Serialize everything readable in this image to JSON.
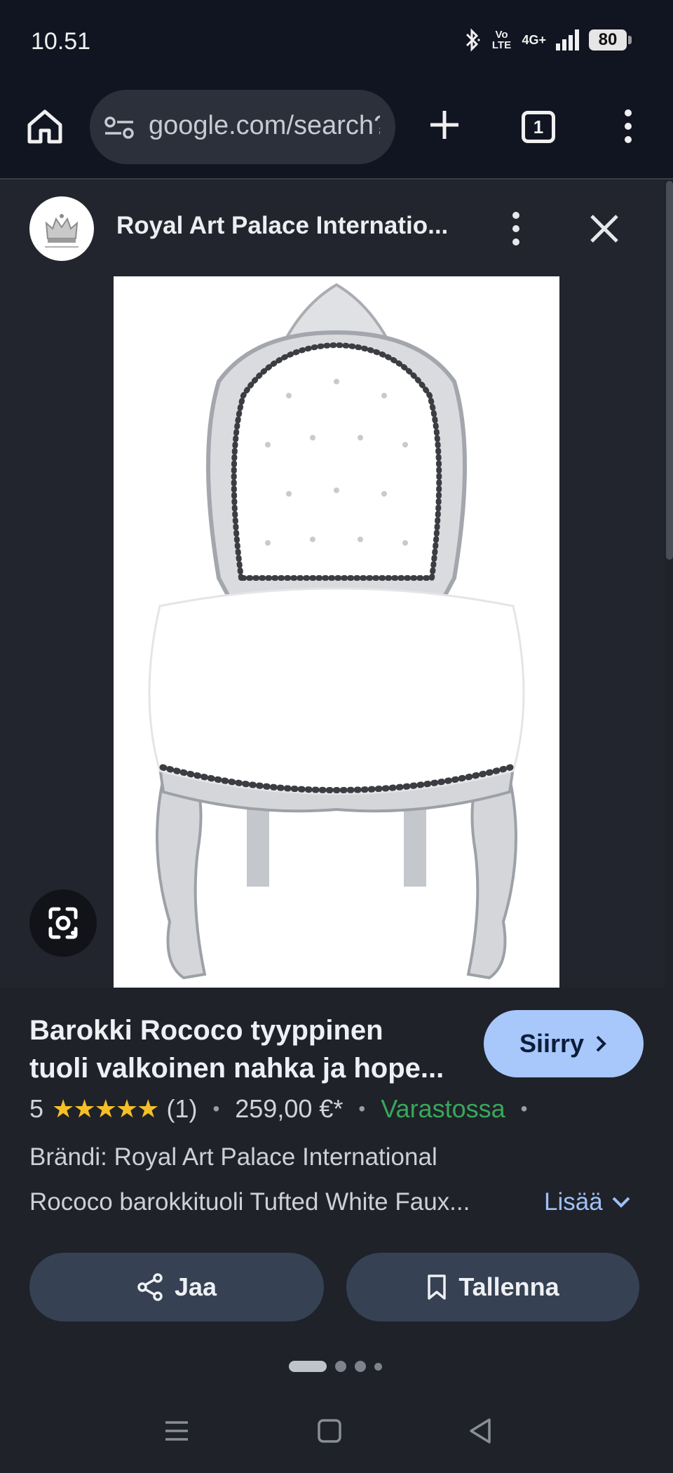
{
  "status": {
    "time": "10.51",
    "volte": "Vo LTE",
    "network": "4G+",
    "battery": "80"
  },
  "browser": {
    "url": "google.com/search?",
    "tab_count": "1"
  },
  "panel": {
    "site_name": "Royal Art Palace Internatio..."
  },
  "product": {
    "title_line1": "Barokki Rococo tyyppinen",
    "title_line2": "tuoli valkoinen nahka ja hope...",
    "go_button": "Siirry",
    "rating": "5",
    "stars": 5,
    "reviews": "(1)",
    "price": "259,00 €*",
    "availability": "Varastossa",
    "brand": "Brändi: Royal Art Palace International",
    "description": "Rococo barokkituoli Tufted White Faux...",
    "more_label": "Lisää"
  },
  "actions": {
    "share_label": "Jaa",
    "save_label": "Tallenna"
  },
  "colors": {
    "accent_button": "#a8c7fa",
    "in_stock": "#38a85a",
    "star": "#f5c026"
  }
}
